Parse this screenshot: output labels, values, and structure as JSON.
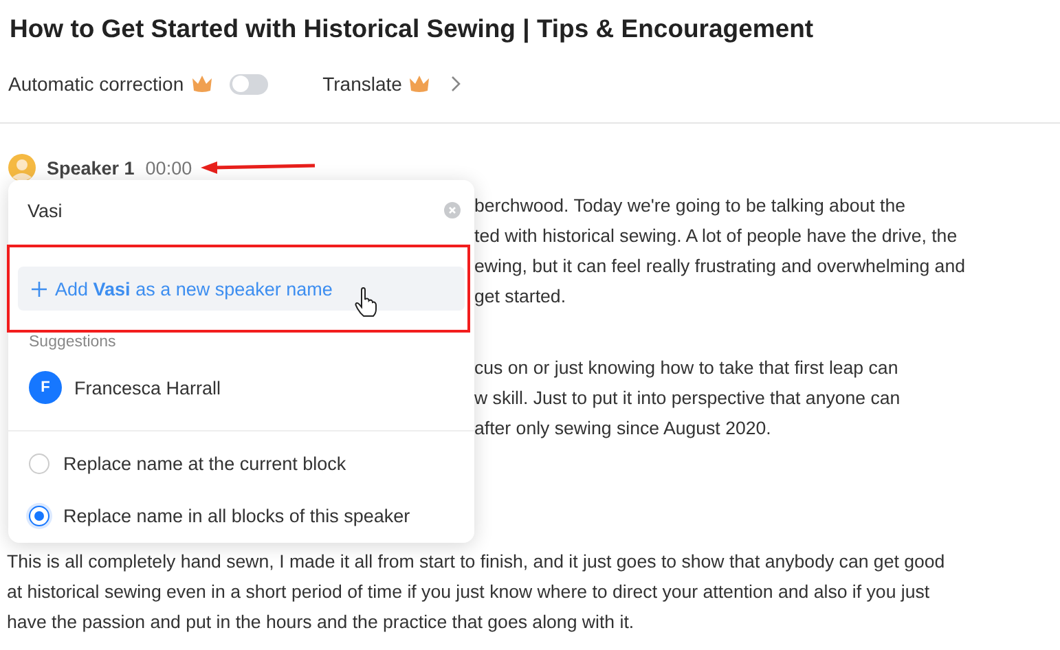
{
  "title": "How to Get Started with Historical Sewing | Tips & Encouragement",
  "toolbar": {
    "auto_correction": {
      "label": "Automatic correction",
      "premium": true,
      "on": false
    },
    "translate": {
      "label": "Translate",
      "premium": true
    }
  },
  "speaker": {
    "name": "Speaker 1",
    "time": "00:00"
  },
  "paragraphs": [
    {
      "covered": true,
      "lines": [
        "berchwood. Today we're going to be talking about the",
        "ted with historical sewing. A lot of people have the drive, the",
        "ewing, but it can feel really frustrating and overwhelming and",
        "get started."
      ]
    },
    {
      "covered": true,
      "lines": [
        "cus on or just knowing how to take that first leap can",
        "w skill. Just to put it into perspective that anyone can",
        "after only sewing since August 2020."
      ]
    },
    {
      "covered": false,
      "lines": [
        "This is all completely hand sewn, I made it all from start to finish, and it just goes to show that anybody can get good",
        "at historical sewing even in a short period of time if you just know where to direct your attention and also if you just",
        "have the passion and put in the hours and the practice that goes along with it."
      ]
    }
  ],
  "popup": {
    "input_value": "Vasi",
    "add_option": "Add **Vasi** as a new speaker name",
    "suggestions_heading": "Suggestions",
    "suggestions": [
      {
        "initial": "F",
        "name": "Francesca Harrall"
      }
    ],
    "scope_options": [
      {
        "label": "Replace name at the current block",
        "selected": false
      },
      {
        "label": "Replace name in all blocks of this speaker",
        "selected": true
      }
    ]
  }
}
